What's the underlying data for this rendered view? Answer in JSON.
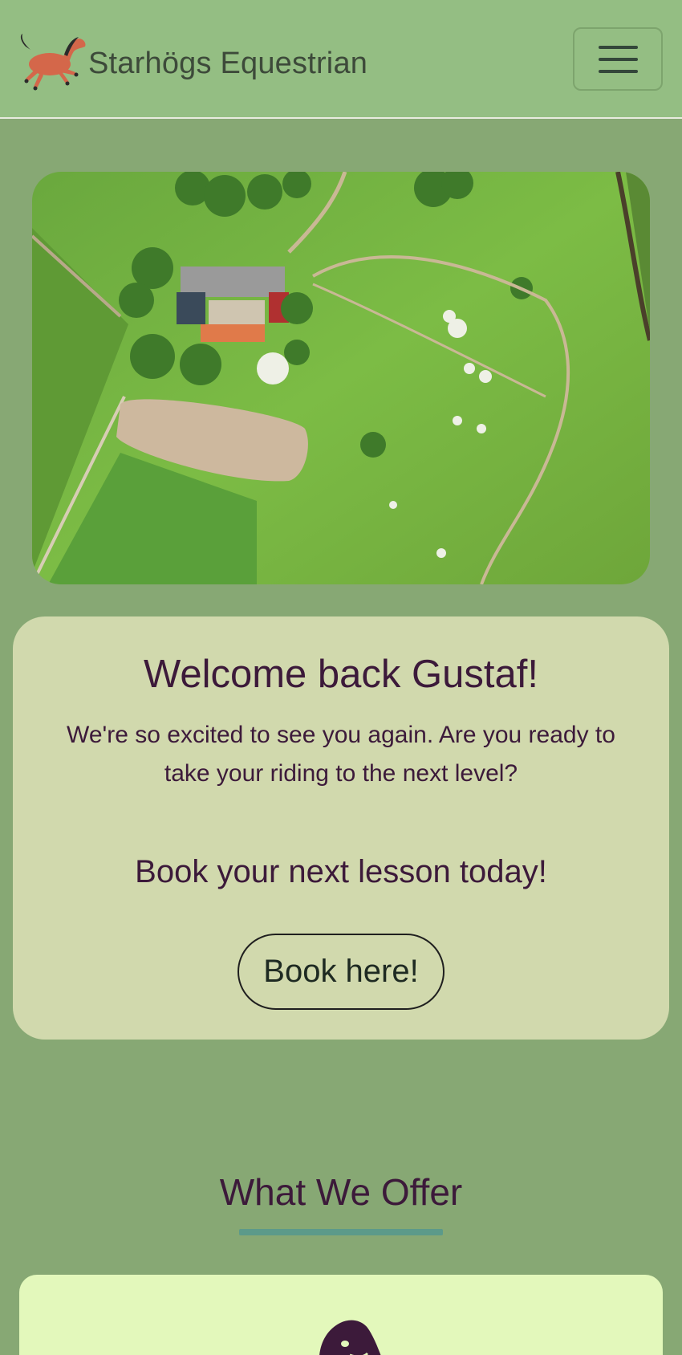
{
  "navbar": {
    "brand_name": "Starhögs Equestrian",
    "logo_icon": "running-horse-icon",
    "menu_icon": "hamburger-menu-icon"
  },
  "hero": {
    "image": "aerial-farm-photo"
  },
  "welcome": {
    "heading": "Welcome back Gustaf!",
    "message": "We're so excited to see you again. Are you ready to take your riding to the next level?",
    "subheading": "Book your next lesson today!",
    "button_label": "Book here!"
  },
  "offer": {
    "title": "What We Offer",
    "card_icon": "horse-head-icon"
  },
  "colors": {
    "background": "#87a874",
    "navbar": "#94be83",
    "card": "#d1d9ad",
    "offer_card": "#e3f8bb",
    "text_accent": "#3c1a3a",
    "underline": "#5c9a8a"
  }
}
